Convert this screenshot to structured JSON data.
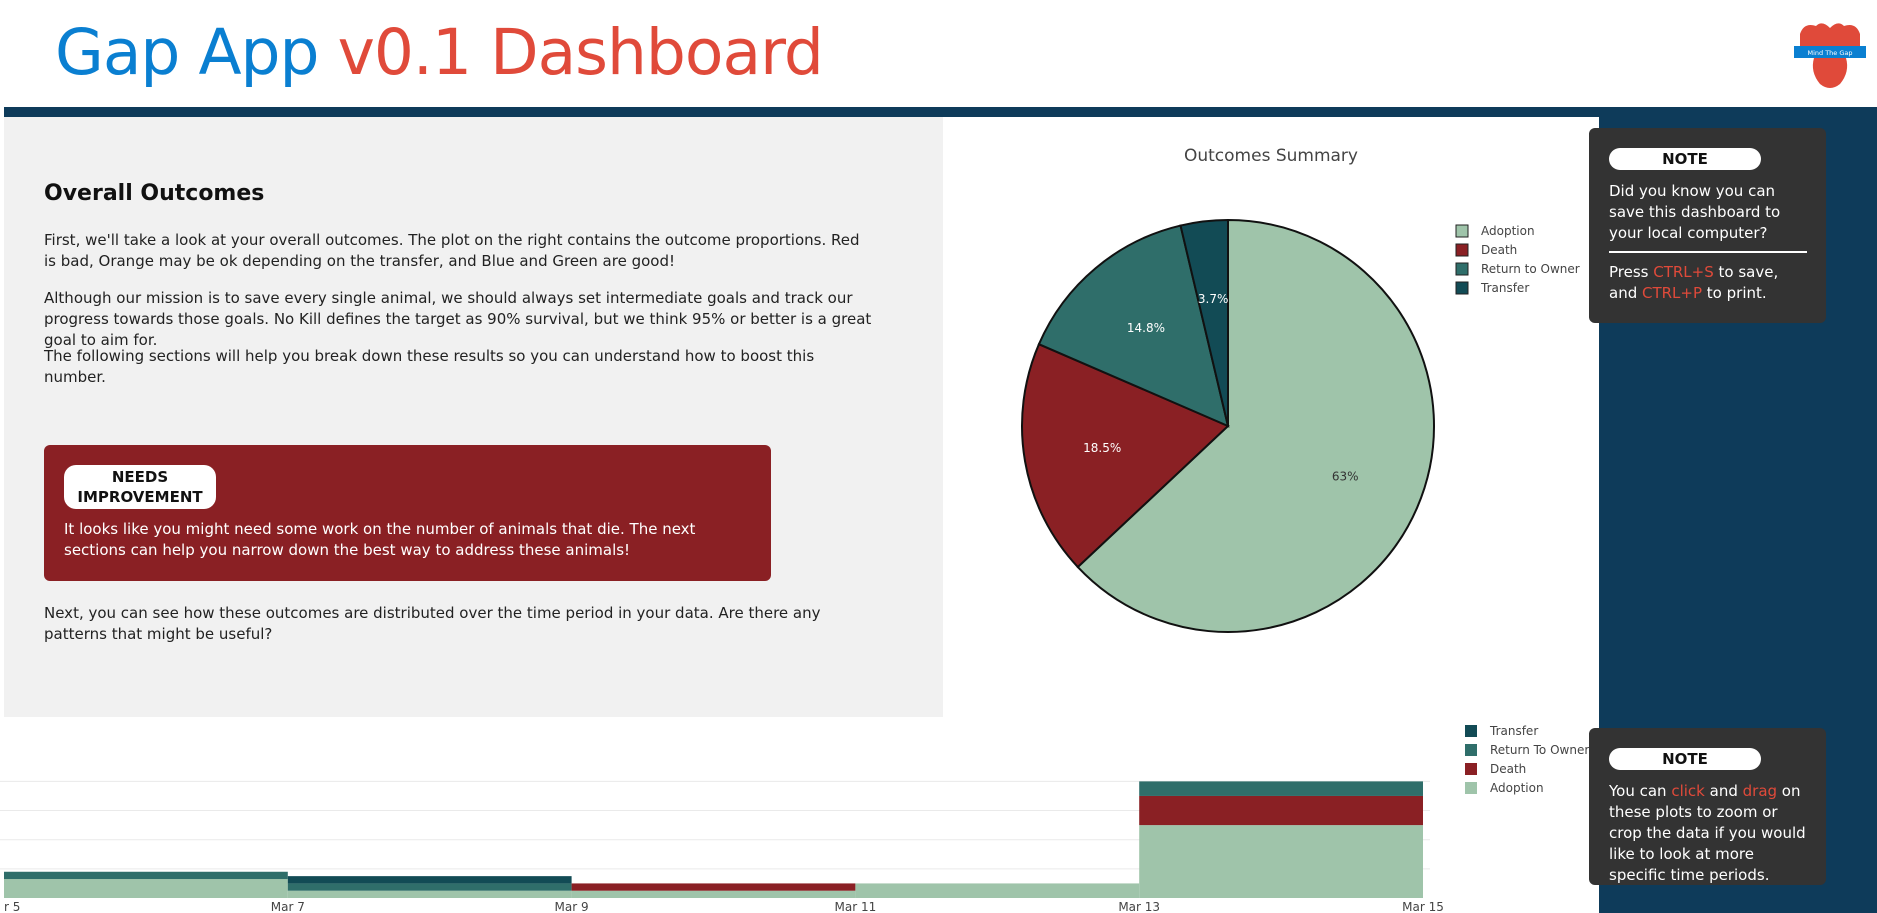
{
  "header": {
    "title_part1": "Gap App",
    "title_part2": "v0.1 Dashboard",
    "logo_text": "Mind The Gap"
  },
  "intro": {
    "heading": "Overall Outcomes",
    "p1": "First, we'll take a look at your overall outcomes. The plot on the right contains the outcome proportions. Red is bad, Orange may be ok depending on the transfer, and Blue and Green are good!",
    "p2": "Although our mission is to save every single animal, we should always set intermediate goals and track our progress towards those goals. No Kill defines the target as 90% survival, but we think 95% or better is a great goal to aim for.",
    "p3": "The following sections will help you break down these results so you can understand how to boost this number.",
    "p4": "Next, you can see how these outcomes are distributed over the time period in your data. Are there any patterns that might be useful?"
  },
  "alert": {
    "badge": "NEEDS IMPROVEMENT",
    "text": "It looks like you might need some work on the number of animals that die. The next sections can help you narrow down the best way to address these animals!"
  },
  "note1": {
    "badge": "NOTE",
    "line1": "Did you know you can save this dashboard to your local computer?",
    "line2_prefix": "Press ",
    "line2_key1": "CTRL+S",
    "line2_mid": " to save, and ",
    "line2_key2": "CTRL+P",
    "line2_suffix": " to print."
  },
  "note2": {
    "badge": "NOTE",
    "prefix": "You can ",
    "word1": "click",
    "mid": " and ",
    "word2": "drag",
    "suffix": " on these plots to zoom or crop the data if you would like to look at more specific time periods."
  },
  "colors": {
    "adoption": "#9fc4aa",
    "death": "#8a2024",
    "return_to_owner": "#2f6e6a",
    "transfer": "#124b55",
    "title_blue": "#0a7fd1",
    "title_red": "#e04a3a",
    "panel_navy": "#0e3b5a"
  },
  "chart_data": [
    {
      "type": "pie",
      "title": "Outcomes Summary",
      "labels": [
        "Adoption",
        "Death",
        "Return to Owner",
        "Transfer"
      ],
      "values": [
        63,
        18.5,
        14.8,
        3.7
      ],
      "value_labels": [
        "63%",
        "18.5%",
        "14.8%",
        "3.7%"
      ],
      "legend": "top-right"
    },
    {
      "type": "bar",
      "stacked": true,
      "x": [
        "r 5",
        "Mar 7",
        "Mar 9",
        "Mar 11",
        "Mar 13",
        "Mar 15"
      ],
      "series": [
        {
          "name": "Adoption",
          "values": [
            1.3,
            0.5,
            0.5,
            1,
            5
          ]
        },
        {
          "name": "Death",
          "values": [
            0,
            0,
            0.5,
            0,
            2
          ]
        },
        {
          "name": "Return To Owner",
          "values": [
            0.5,
            0.5,
            0,
            0,
            1
          ]
        },
        {
          "name": "Transfer",
          "values": [
            0,
            0.5,
            0,
            0,
            0
          ]
        }
      ],
      "ylim": [
        0,
        8
      ],
      "legend": "top-right"
    }
  ]
}
